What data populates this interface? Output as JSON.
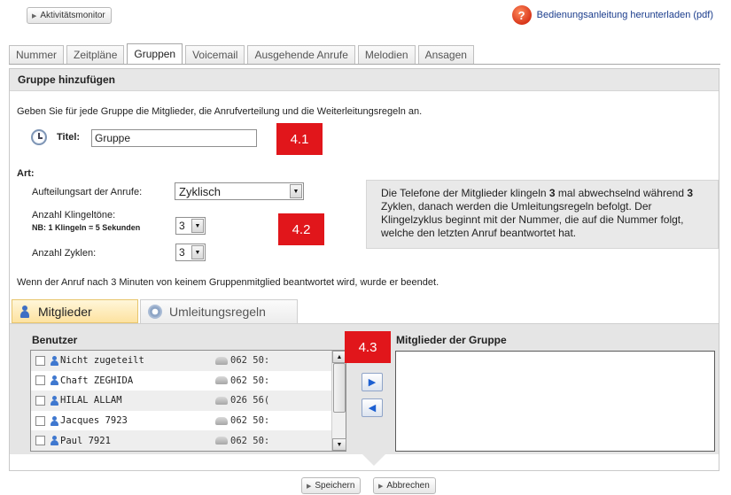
{
  "top": {
    "monitor_button": "Aktivitätsmonitor",
    "manual_link": "Bedienungsanleitung herunterladen (pdf)"
  },
  "tabs": [
    {
      "label": "Nummer",
      "active": false
    },
    {
      "label": "Zeitpläne",
      "active": false
    },
    {
      "label": "Gruppen",
      "active": true
    },
    {
      "label": "Voicemail",
      "active": false
    },
    {
      "label": "Ausgehende Anrufe",
      "active": false
    },
    {
      "label": "Melodien",
      "active": false
    },
    {
      "label": "Ansagen",
      "active": false
    }
  ],
  "panel": {
    "header": "Gruppe hinzufügen",
    "intro": "Geben Sie für jede Gruppe die Mitglieder, die Anrufverteilung und die Weiterleitungsregeln an.",
    "title_label": "Titel:",
    "title_value": "Gruppe",
    "art_label": "Art:",
    "distribution_label": "Aufteilungsart der Anrufe:",
    "distribution_value": "Zyklisch",
    "rings_label": "Anzahl Klingeltöne:",
    "rings_note": "NB: 1 Klingeln = 5 Sekunden",
    "rings_value": "3",
    "cycles_label": "Anzahl Zyklen:",
    "cycles_value": "3",
    "info_pre": "Die Telefone der Mitglieder klingeln ",
    "info_rings": "3",
    "info_mid": " mal abwechselnd während ",
    "info_cycles": "3",
    "info_post": " Zyklen, danach werden die Umleitungsregeln befolgt. Der Klingelzyklus beginnt mit der Nummer, die auf die Nummer folgt, welche den letzten Anruf beantwortet hat.",
    "timeout_note": "Wenn der Anruf nach 3 Minuten von keinem Gruppenmitglied beantwortet wird, wurde er beendet."
  },
  "subtabs": {
    "members": "Mitglieder",
    "forwarding": "Umleitungsregeln"
  },
  "members": {
    "users_title": "Benutzer",
    "group_title": "Mitglieder der Gruppe",
    "users": [
      {
        "name": "Nicht zugeteilt",
        "phone": "062 50:"
      },
      {
        "name": "Chaft ZEGHIDA",
        "phone": "062 50:"
      },
      {
        "name": "HILAL ALLAM",
        "phone": "026 56("
      },
      {
        "name": "Jacques 7923",
        "phone": "062 50:"
      },
      {
        "name": "Paul 7921",
        "phone": "062 50:"
      }
    ]
  },
  "badges": {
    "b41": "4.1",
    "b42": "4.2",
    "b43": "4.3"
  },
  "footer": {
    "save": "Speichern",
    "cancel": "Abbrechen"
  },
  "colors": {
    "badge_red": "#e1161b",
    "tab_members_bg": "#fde2a0",
    "members_area_bg": "#e5e5e5",
    "link_blue": "#1a3c8c"
  }
}
